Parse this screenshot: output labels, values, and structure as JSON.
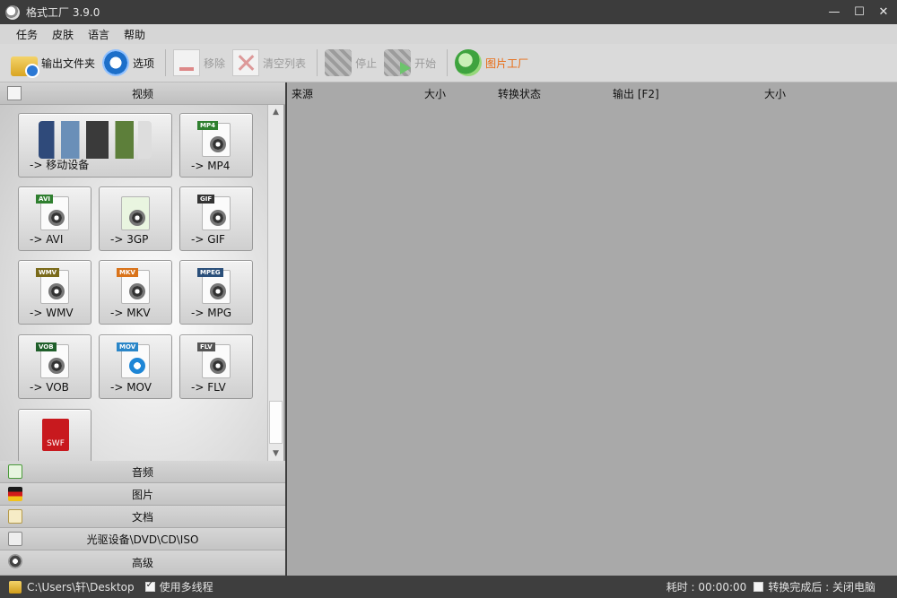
{
  "window": {
    "title": "格式工厂 3.9.0",
    "controls": {
      "minimize": "—",
      "maximize": "☐",
      "close": "✕"
    }
  },
  "menu": [
    "任务",
    "皮肤",
    "语言",
    "帮助"
  ],
  "toolbar": {
    "output_folder": "输出文件夹",
    "options": "选项",
    "remove": "移除",
    "clear_list": "清空列表",
    "stop": "停止",
    "start": "开始",
    "picture_factory": "图片工厂"
  },
  "colors": {
    "accent": "#e86a10"
  },
  "left_panel": {
    "video_category": "视频",
    "formats": [
      {
        "label": "-> 移动设备",
        "icon": "mobile-devices-icon"
      },
      {
        "label": "-> MP4",
        "tag": "MP4",
        "icon": "mp4-icon"
      },
      {
        "label": "-> AVI",
        "tag": "AVI",
        "icon": "avi-icon"
      },
      {
        "label": "-> 3GP",
        "tag": "",
        "icon": "3gp-icon"
      },
      {
        "label": "-> GIF",
        "tag": "GIF",
        "icon": "gif-icon"
      },
      {
        "label": "-> WMV",
        "tag": "WMV",
        "icon": "wmv-icon"
      },
      {
        "label": "-> MKV",
        "tag": "MKV",
        "icon": "mkv-icon"
      },
      {
        "label": "-> MPG",
        "tag": "MPEG",
        "icon": "mpg-icon"
      },
      {
        "label": "-> VOB",
        "tag": "VOB",
        "icon": "vob-icon"
      },
      {
        "label": "-> MOV",
        "tag": "MOV",
        "icon": "mov-icon"
      },
      {
        "label": "-> FLV",
        "tag": "FLV",
        "icon": "flv-icon"
      },
      {
        "label": "",
        "tag": "SWF",
        "icon": "swf-icon"
      }
    ],
    "categories": [
      "音频",
      "图片",
      "文档",
      "光驱设备\\DVD\\CD\\ISO",
      "高级"
    ]
  },
  "task_list": {
    "columns": [
      "来源",
      "大小",
      "转换状态",
      "输出 [F2]",
      "大小"
    ]
  },
  "status_bar": {
    "path": "C:\\Users\\轩\\Desktop",
    "multithread_label": "使用多线程",
    "multithread_checked": true,
    "elapsed": "耗时 : 00:00:00",
    "after_convert_label": "转换完成后 : 关闭电脑",
    "after_convert_checked": false
  }
}
